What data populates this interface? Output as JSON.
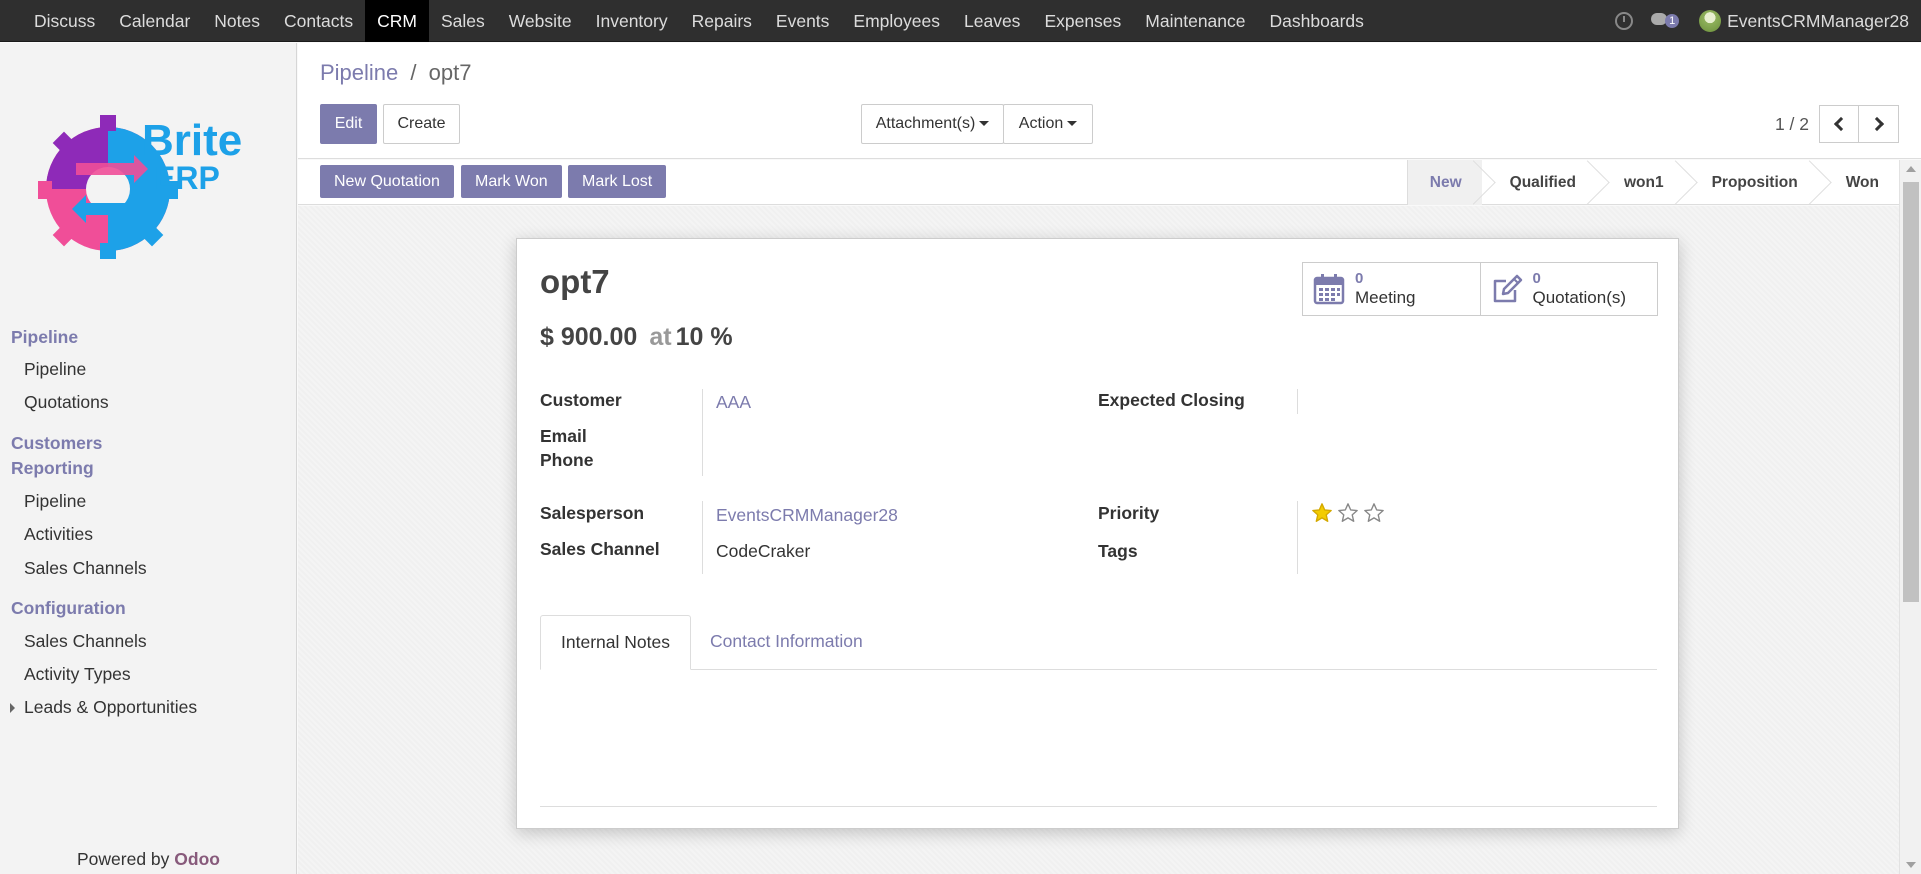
{
  "topnav": {
    "menu": [
      "Discuss",
      "Calendar",
      "Notes",
      "Contacts",
      "CRM",
      "Sales",
      "Website",
      "Inventory",
      "Repairs",
      "Events",
      "Employees",
      "Leaves",
      "Expenses",
      "Maintenance",
      "Dashboards"
    ],
    "active": "CRM",
    "message_count": "1",
    "user_name": "EventsCRMManager28"
  },
  "logo": {
    "word1": "Brite",
    "word2": "ERP"
  },
  "sidebar": {
    "sec_pipeline": "Pipeline",
    "pipeline_items": [
      "Pipeline",
      "Quotations"
    ],
    "sec_customers": "Customers",
    "sec_reporting": "Reporting",
    "reporting_items": [
      "Pipeline",
      "Activities",
      "Sales Channels"
    ],
    "sec_configuration": "Configuration",
    "config_items": [
      "Sales Channels",
      "Activity Types",
      "Leads & Opportunities"
    ],
    "powered_by": "Powered by",
    "powered_brand": "Odoo"
  },
  "control": {
    "breadcrumb_parent": "Pipeline",
    "breadcrumb_sep": "/",
    "breadcrumb_current": "opt7",
    "edit_label": "Edit",
    "create_label": "Create",
    "attachments_label": "Attachment(s)",
    "action_label": "Action",
    "pager_value": "1 / 2"
  },
  "statusbar": {
    "buttons": [
      "New Quotation",
      "Mark Won",
      "Mark Lost"
    ],
    "stages": [
      "New",
      "Qualified",
      "won1",
      "Proposition",
      "Won"
    ],
    "active_stage": "New"
  },
  "record": {
    "name": "opt7",
    "revenue": "$ 900.00",
    "at_label": "at",
    "probability": "10 %",
    "meeting_count": "0",
    "meeting_label": "Meeting",
    "quotation_count": "0",
    "quotation_label": "Quotation(s)",
    "labels": {
      "customer": "Customer",
      "email": "Email",
      "phone": "Phone",
      "salesperson": "Salesperson",
      "sales_channel": "Sales Channel",
      "expected_closing": "Expected Closing",
      "priority": "Priority",
      "tags": "Tags"
    },
    "customer": "AAA",
    "salesperson": "EventsCRMManager28",
    "sales_channel": "CodeCraker",
    "priority": 1,
    "priority_max": 3,
    "star_color": "#f3cc00"
  },
  "tabs": [
    "Internal Notes",
    "Contact Information"
  ],
  "colors": {
    "brand": "#7c7bad",
    "navbar": "#2f2f2f"
  }
}
